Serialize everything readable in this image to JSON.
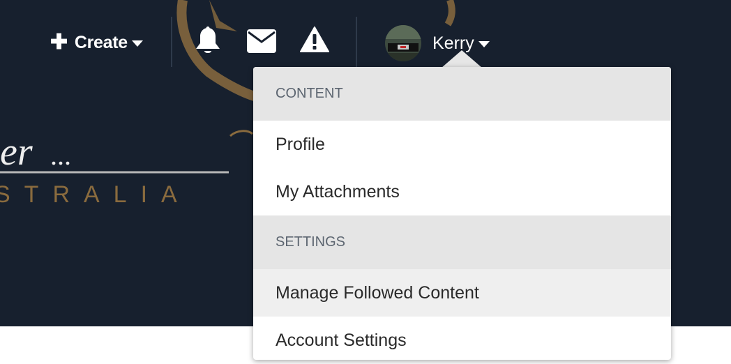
{
  "header": {
    "create_label": "Create",
    "user_name": "Kerry",
    "background_text": "STRALIA",
    "colors": {
      "background": "#17202e",
      "gold": "#8a6b3e",
      "text": "#ffffff"
    }
  },
  "icons": {
    "create": "plus-icon",
    "notifications": "bell-icon",
    "messages": "envelope-icon",
    "alerts": "warning-icon",
    "avatar": "avatar"
  },
  "dropdown": {
    "sections": [
      {
        "heading": "CONTENT",
        "items": [
          "Profile",
          "My Attachments"
        ]
      },
      {
        "heading": "SETTINGS",
        "items": [
          "Manage Followed Content",
          "Account Settings"
        ]
      }
    ]
  }
}
